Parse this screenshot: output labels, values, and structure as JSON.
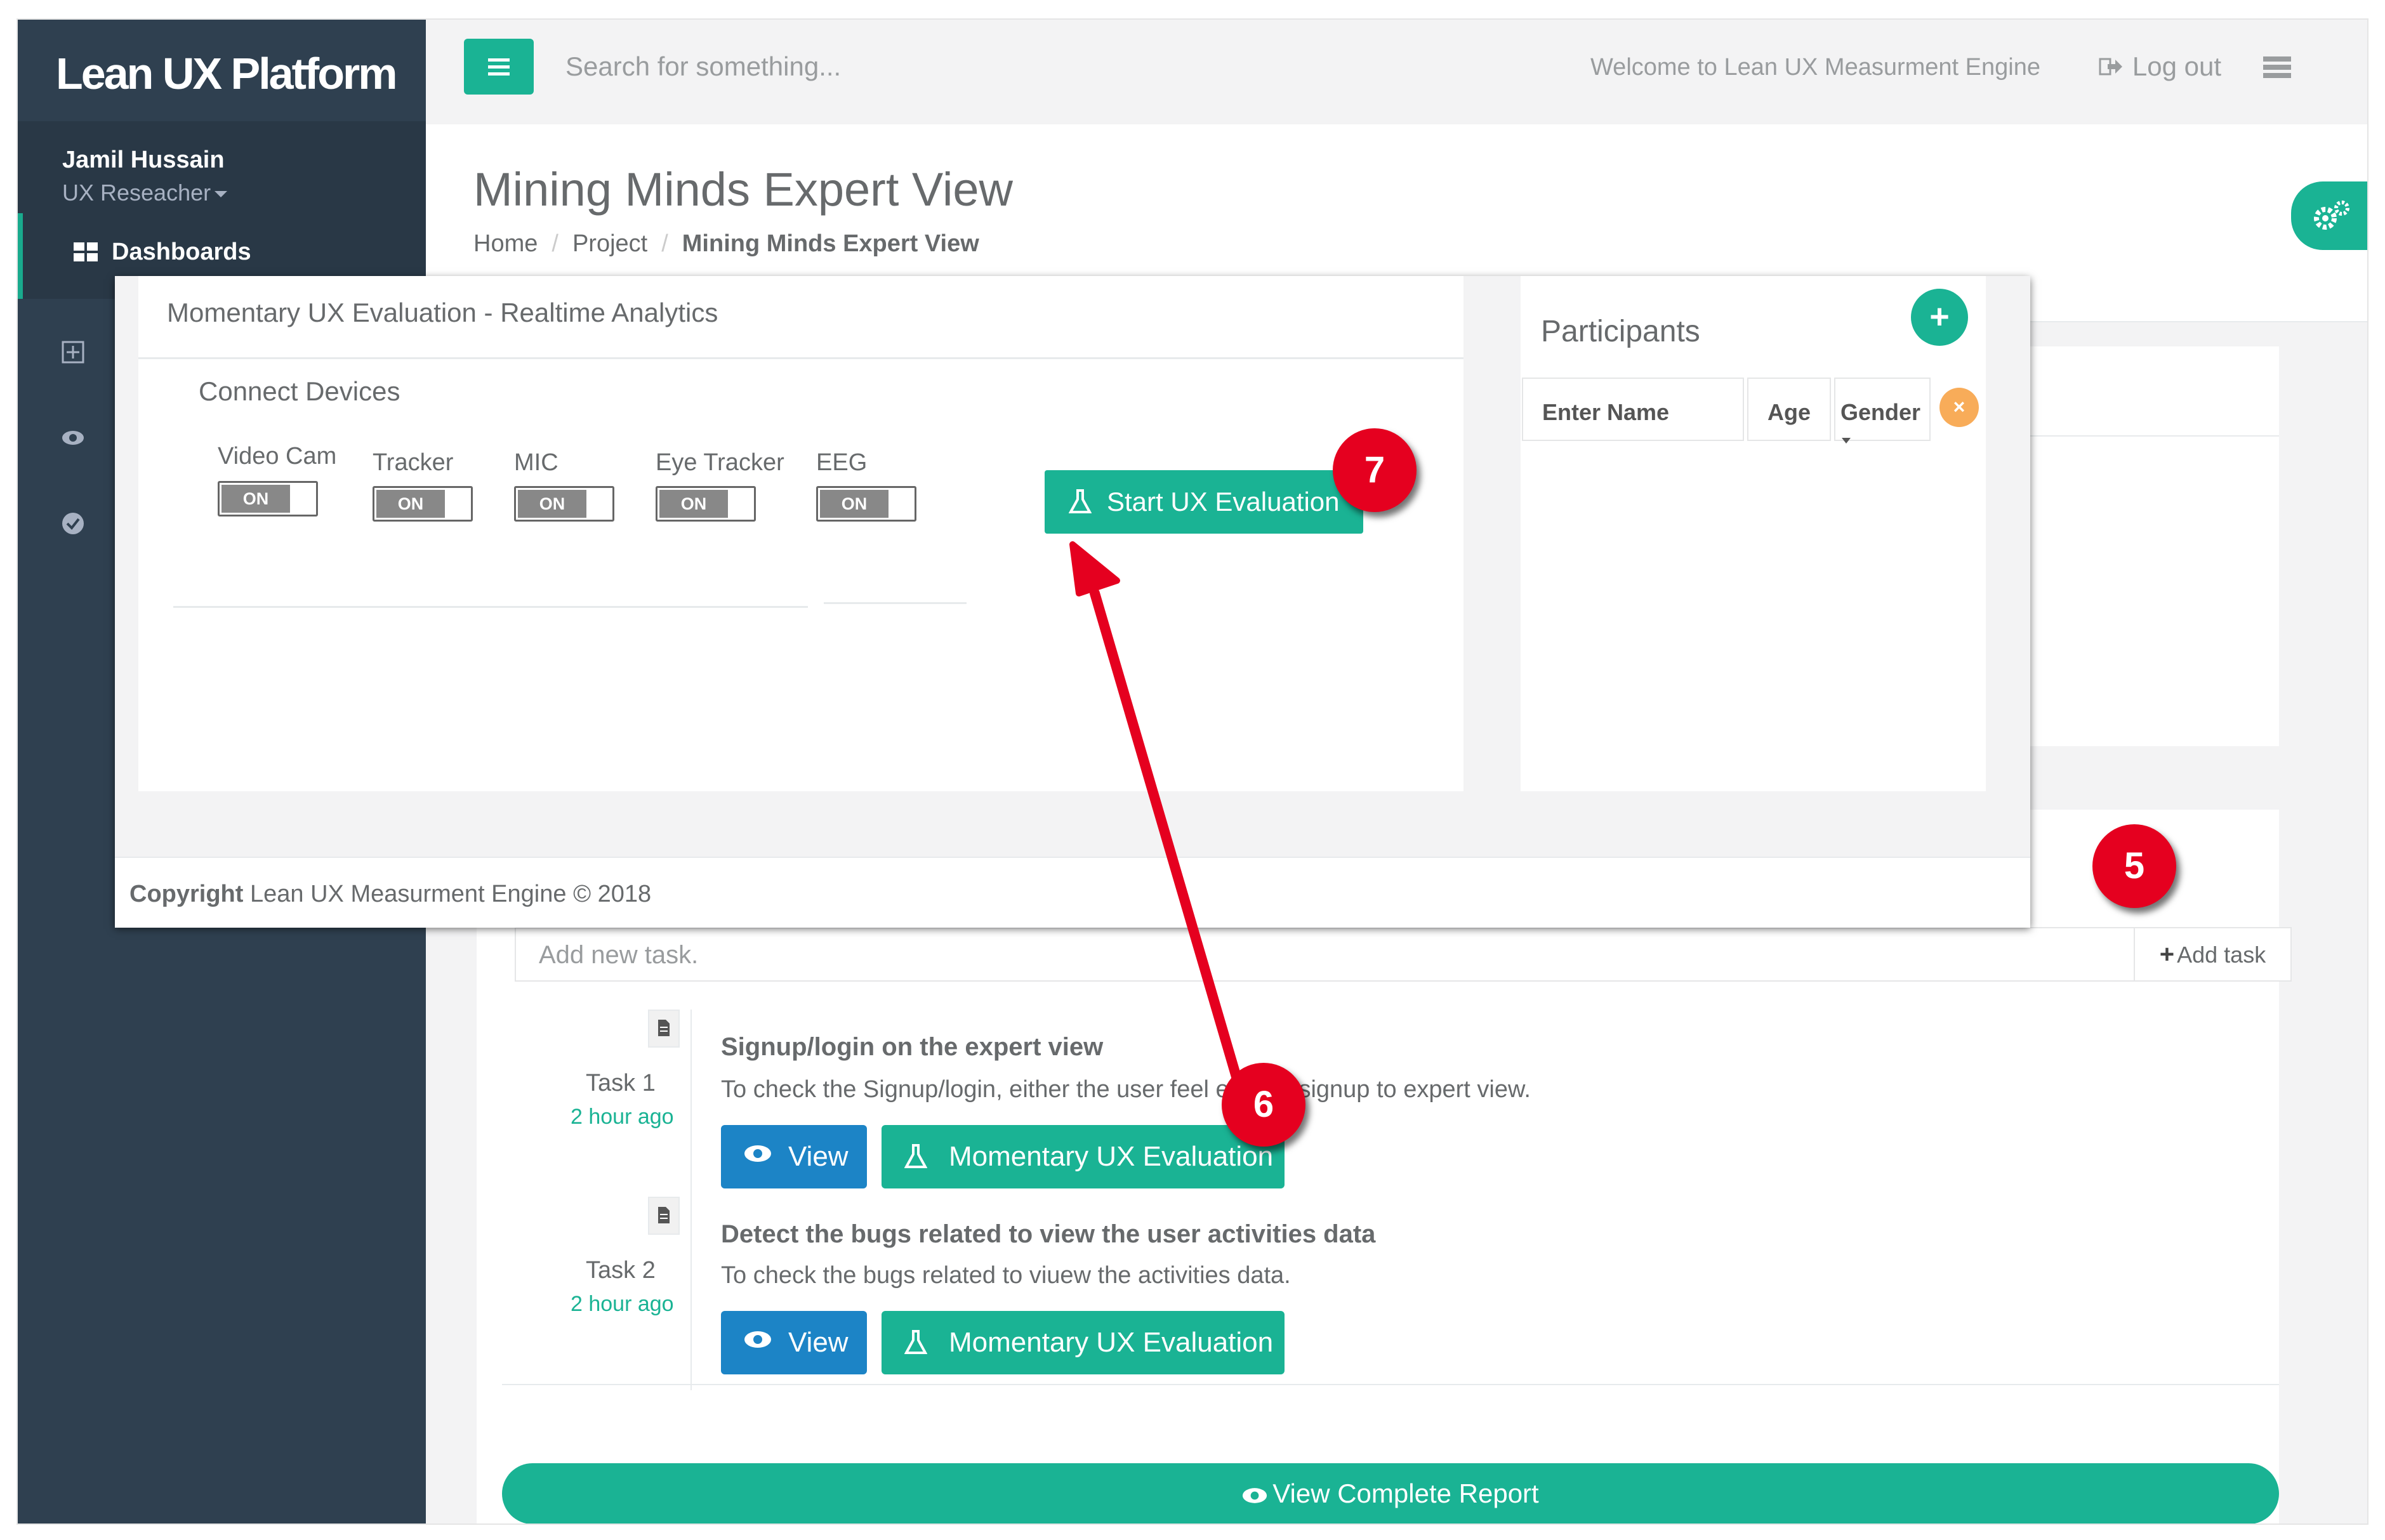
{
  "app": {
    "brand": "Lean UX Platform"
  },
  "user": {
    "name": "Jamil Hussain",
    "role": "UX Reseacher"
  },
  "nav": {
    "active_label": "Dashboards"
  },
  "topbar": {
    "search_placeholder": "Search for something...",
    "welcome": "Welcome to Lean UX Measurment Engine",
    "logout": "Log out"
  },
  "page": {
    "title": "Mining Minds Expert View",
    "breadcrumb": [
      "Home",
      "Project",
      "Mining Minds Expert View"
    ]
  },
  "modal": {
    "title": "Momentary UX Evaluation - Realtime Analytics",
    "connect_title": "Connect Devices",
    "devices": [
      {
        "label": "Video Cam",
        "state": "ON"
      },
      {
        "label": "Tracker",
        "state": "ON"
      },
      {
        "label": "MIC",
        "state": "ON"
      },
      {
        "label": "Eye Tracker",
        "state": "ON"
      },
      {
        "label": "EEG",
        "state": "ON"
      }
    ],
    "start_button": "Start UX Evaluation",
    "participants": {
      "title": "Participants",
      "add": "+",
      "name_placeholder": "Enter Name",
      "age": "Age",
      "gender": "Gender",
      "remove": "×"
    },
    "footer": {
      "copyright_label": "Copyright",
      "copyright_text": "Lean UX Measurment Engine © 2018"
    }
  },
  "tasks": {
    "input_placeholder": "Add new task.",
    "add_button": "Add task",
    "items": [
      {
        "number": "Task 1",
        "time": "2 hour ago",
        "title": "Signup/login on the expert view",
        "description": "To check the Signup/login, either the user feel easy in signup to expert view.",
        "view": "View",
        "momentary": "Momentary UX Evaluation"
      },
      {
        "number": "Task 2",
        "time": "2 hour ago",
        "title": "Detect the bugs related to view the user activities data",
        "description": "To check the bugs related to viuew the activities data.",
        "view": "View",
        "momentary": "Momentary UX Evaluation"
      }
    ],
    "report_button": "View Complete Report"
  },
  "annotations": {
    "step5": "5",
    "step6": "6",
    "step7": "7"
  },
  "colors": {
    "primary": "#1ab394",
    "info": "#1c84c6",
    "sidebar": "#2f4050",
    "warning": "#f8ac59",
    "annotation": "#e5001f"
  }
}
